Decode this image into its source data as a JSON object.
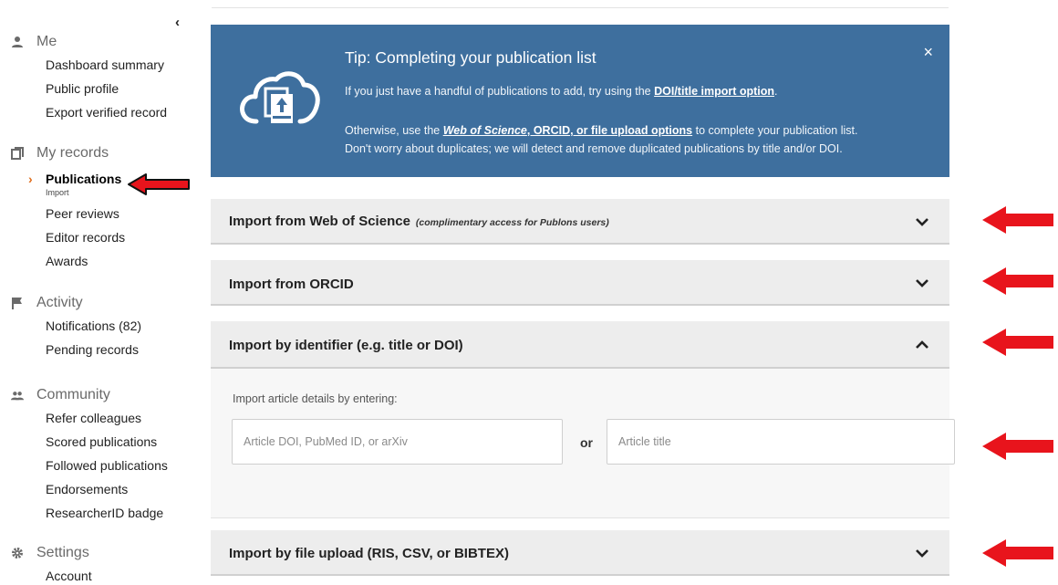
{
  "sidebar": {
    "collapse_icon": "chevron-left-icon",
    "sections": [
      {
        "title": "Me",
        "icon": "person-icon",
        "items": [
          "Dashboard summary",
          "Public profile",
          "Export verified record"
        ]
      },
      {
        "title": "My records",
        "icon": "copy-icon",
        "active_item": "Publications",
        "active_sub": "Import",
        "items": [
          "Peer reviews",
          "Editor records",
          "Awards"
        ]
      },
      {
        "title": "Activity",
        "icon": "flag-icon",
        "items": [
          "Notifications (82)",
          "Pending records"
        ]
      },
      {
        "title": "Community",
        "icon": "group-icon",
        "items": [
          "Refer colleagues",
          "Scored publications",
          "Followed publications",
          "Endorsements",
          "ResearcherID badge"
        ]
      },
      {
        "title": "Settings",
        "icon": "gear-icon",
        "items": [
          "Account"
        ]
      }
    ]
  },
  "tip": {
    "title": "Tip: Completing your publication list",
    "line1_pre": "If you just have a handful of publications to add, try using the ",
    "line1_link": "DOI/title import option",
    "line1_post": ".",
    "line2_pre": "Otherwise, use the ",
    "line2_link_italic": "Web of Science",
    "line2_link_rest": ", ORCID, or file upload options",
    "line2_post": " to complete your publication list.",
    "line3": "Don't worry about duplicates; we will detect and remove duplicated publications by title and/or DOI.",
    "close_label": "×"
  },
  "panels": {
    "wos": {
      "title": "Import from Web of Science",
      "note": "(complimentary access for Publons users)"
    },
    "orcid": {
      "title": "Import from ORCID"
    },
    "identifier": {
      "title": "Import by identifier (e.g. title or DOI)",
      "body_label": "Import article details by entering:",
      "doi_placeholder": "Article DOI, PubMed ID, or arXiv",
      "or_label": "or",
      "title_placeholder": "Article title"
    },
    "file": {
      "title": "Import by file upload (RIS, CSV, or BIBTEX)"
    }
  },
  "colors": {
    "tip_bg": "#3e6f9e",
    "panel_bg": "#ededed",
    "accent_caret": "#e06d1c",
    "annotation_arrow": "#e8141c"
  }
}
